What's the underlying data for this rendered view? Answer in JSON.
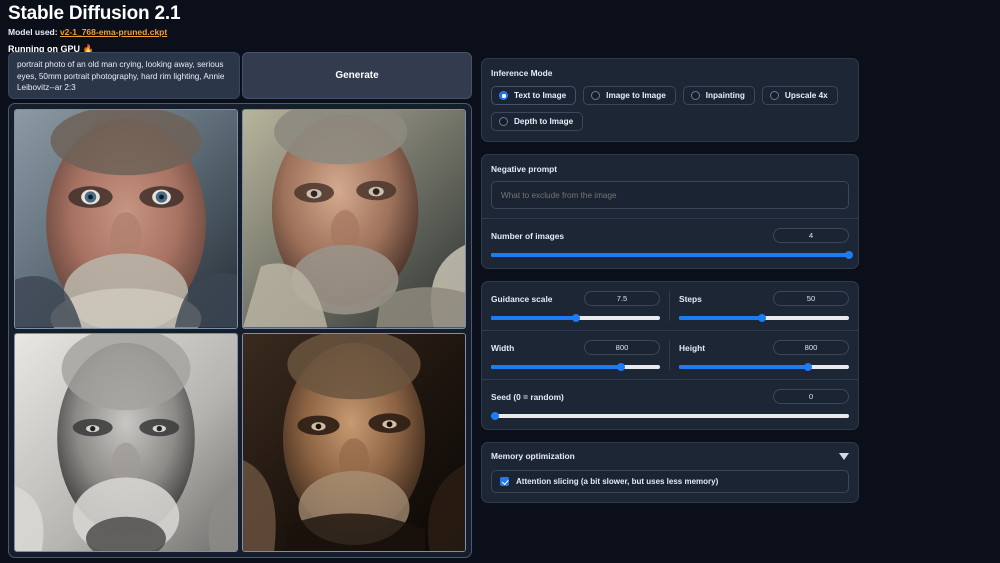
{
  "header": {
    "title": "Stable Diffusion 2.1",
    "model_prefix": "Model used: ",
    "model_link": "v2-1_768-ema-pruned.ckpt",
    "status": "Running on GPU",
    "status_icon": "fire-emoji"
  },
  "prompt": {
    "value": "portrait photo of an old man crying, looking away, serious eyes, 50mm portrait photography, hard rim lighting, Annie Leibovitz--ar 2:3",
    "generate_label": "Generate"
  },
  "gallery": {
    "images": [
      {
        "name": "generated-image-1",
        "alt": "close-up portrait of elderly man with blue eyes"
      },
      {
        "name": "generated-image-2",
        "alt": "elderly man looking down, weathered face"
      },
      {
        "name": "generated-image-3",
        "alt": "black and white portrait of bald elderly man"
      },
      {
        "name": "generated-image-4",
        "alt": "elderly man with beard in warm brown light"
      }
    ]
  },
  "inference_mode": {
    "label": "Inference Mode",
    "selected": "Text to Image",
    "options": [
      {
        "label": "Text to Image",
        "selected": true
      },
      {
        "label": "Image to Image",
        "selected": false
      },
      {
        "label": "Inpainting",
        "selected": false
      },
      {
        "label": "Upscale 4x",
        "selected": false
      },
      {
        "label": "Depth to Image",
        "selected": false
      }
    ]
  },
  "negative_prompt": {
    "label": "Negative prompt",
    "value": "",
    "placeholder": "What to exclude from the image"
  },
  "controls": {
    "number_of_images": {
      "label": "Number of images",
      "value": "4",
      "percent": 100
    },
    "guidance_scale": {
      "label": "Guidance scale",
      "value": "7.5",
      "percent": 50
    },
    "steps": {
      "label": "Steps",
      "value": "50",
      "percent": 49
    },
    "width": {
      "label": "Width",
      "value": "800",
      "percent": 77
    },
    "height": {
      "label": "Height",
      "value": "800",
      "percent": 76
    },
    "seed": {
      "label": "Seed (0 = random)",
      "value": "0",
      "percent": 0
    }
  },
  "memory": {
    "label": "Memory optimization",
    "toggle_icon": "chevron-down-icon",
    "attention_slicing": {
      "label": "Attention slicing (a bit slower, but uses less memory)",
      "checked": true
    }
  },
  "colors": {
    "page_bg": "#0b0f19",
    "panel_bg": "#1d2635",
    "accent_blue": "#1d7cf2",
    "link_orange": "#f0a030",
    "prompt_bg": "#2b3648"
  }
}
